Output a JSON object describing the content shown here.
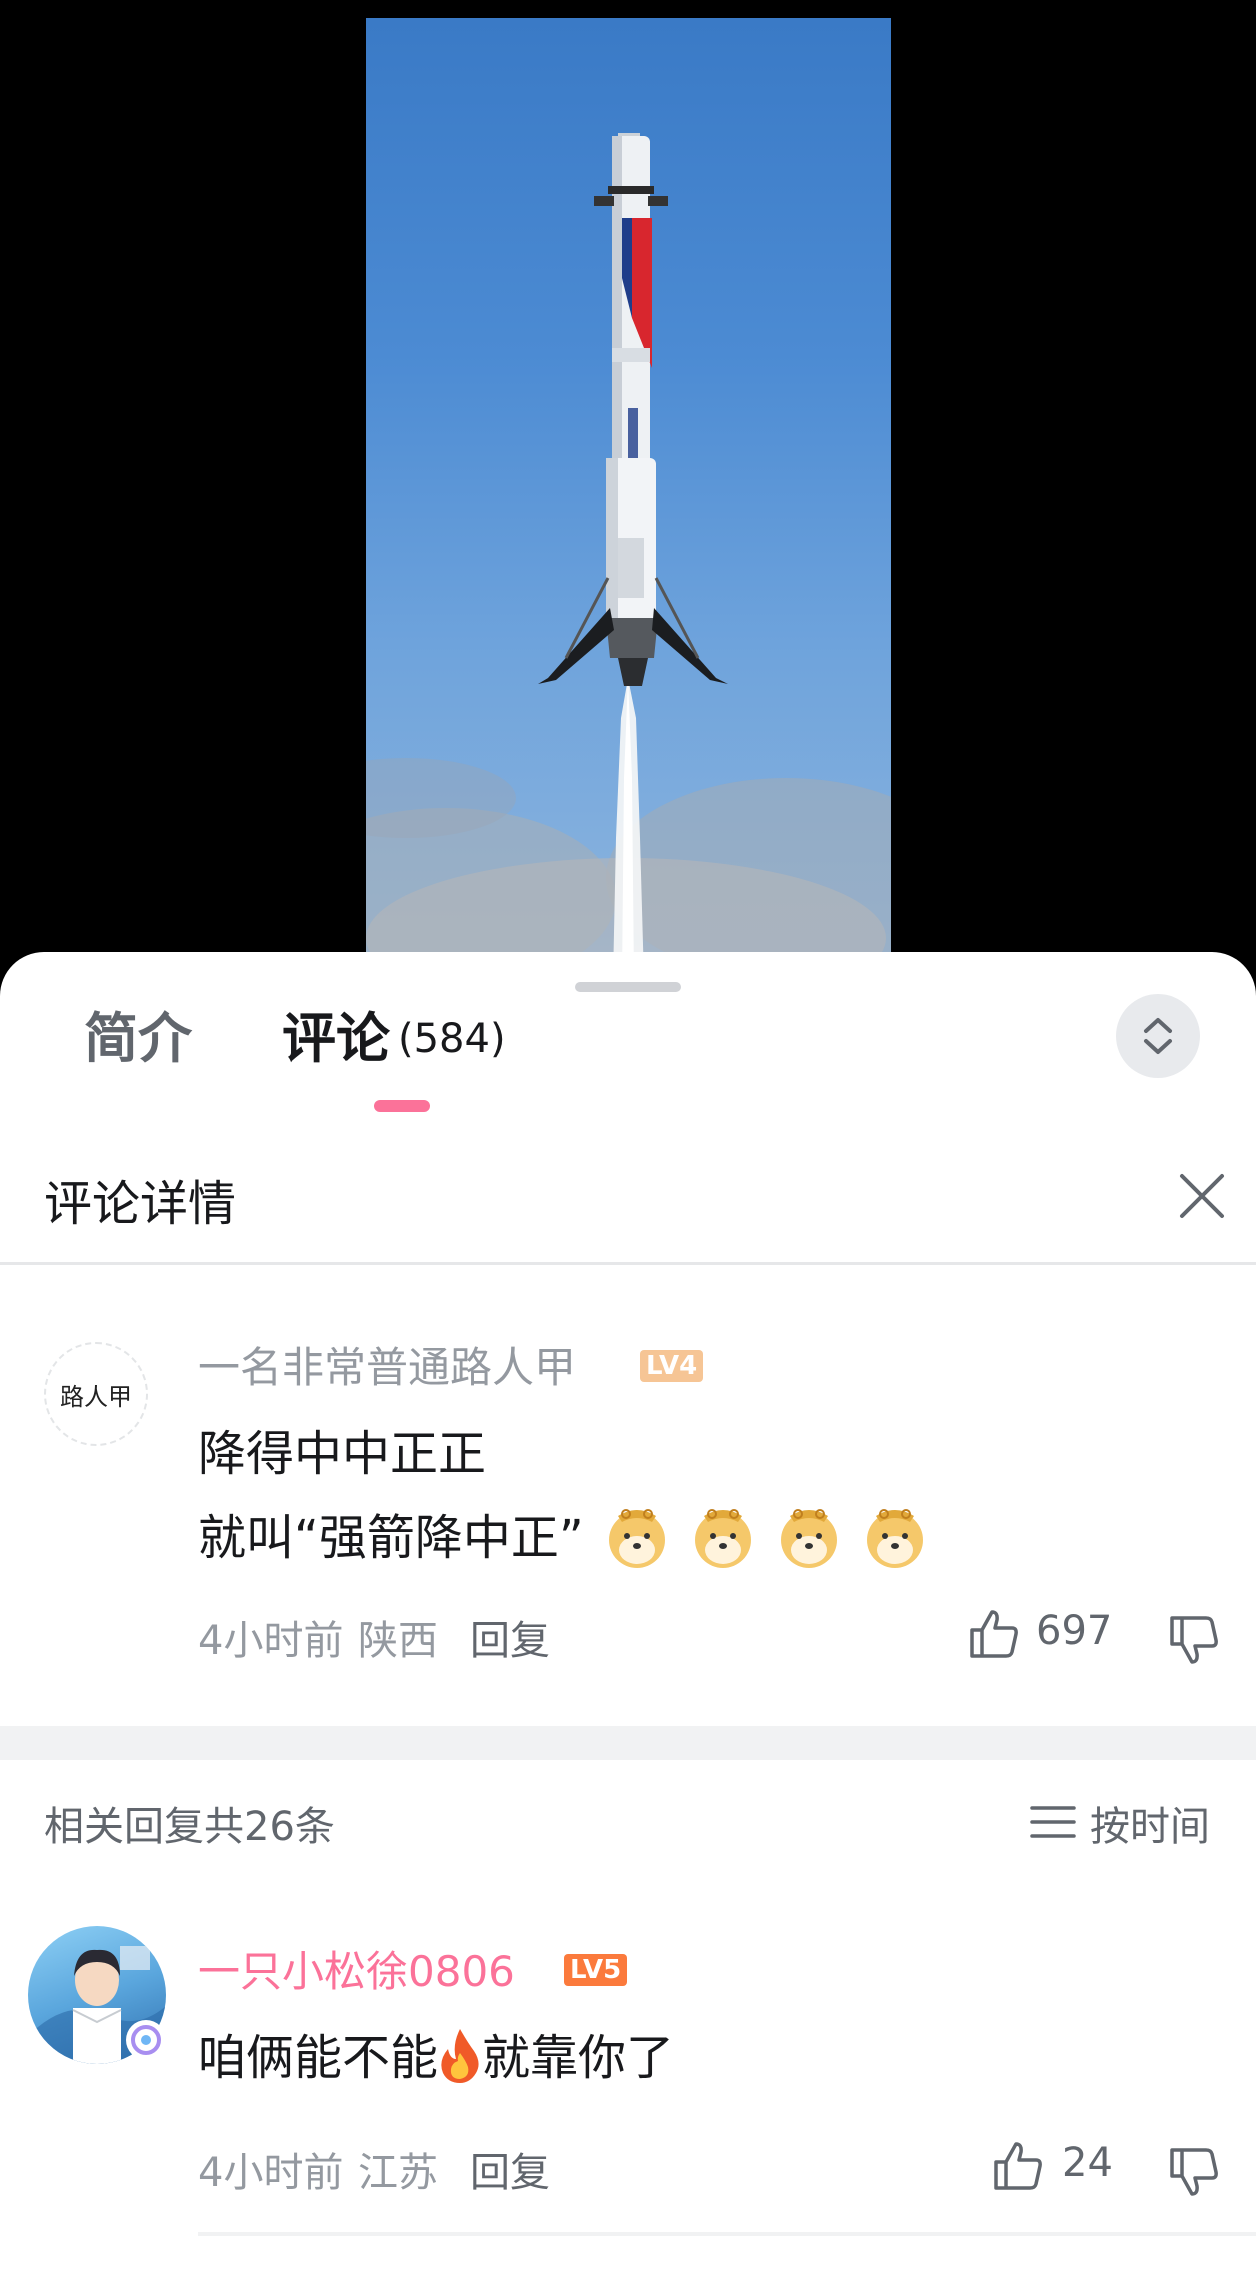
{
  "tabs": {
    "intro_label": "简介",
    "comments_label": "评论",
    "comments_count": "(584)"
  },
  "detail": {
    "title": "评论详情"
  },
  "main_comment": {
    "avatar_text": "路人甲",
    "username": "一名非常普通路人甲",
    "level": "LV4",
    "line1": "降得中中正正",
    "line2": "就叫“强箭降中正”",
    "emoji_icons": [
      "doge-emoji",
      "doge-emoji",
      "doge-emoji",
      "doge-emoji"
    ],
    "time": "4小时前",
    "location": "陕西",
    "reply_label": "回复",
    "likes": "697"
  },
  "replies": {
    "count_label": "相关回复共26条",
    "sort_label": "按时间"
  },
  "reply1": {
    "username": "一只小松徐0806",
    "level": "LV5",
    "text_before": "咱俩能不能",
    "text_after": "就靠你了",
    "emoji_icon": "fire-emoji",
    "time": "4小时前",
    "location": "江苏",
    "reply_label": "回复",
    "likes": "24"
  },
  "colors": {
    "accent": "#fb7299",
    "lv4": "#f6c595",
    "lv5": "#fb7a3c",
    "meta_gray": "#9499a0"
  }
}
